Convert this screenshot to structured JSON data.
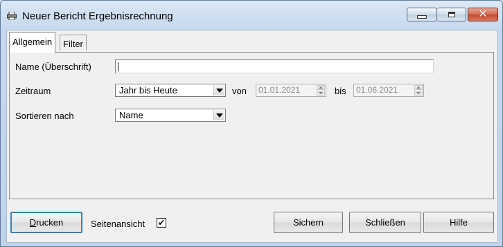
{
  "window": {
    "title": "Neuer Bericht Ergebnisrechnung",
    "controls": {
      "minimize": "minimize",
      "maximize": "maximize",
      "close": "✕"
    }
  },
  "tabs": [
    {
      "label": "Allgemein",
      "active": true
    },
    {
      "label": "Filter",
      "active": false
    }
  ],
  "form": {
    "name_label": "Name (Überschrift)",
    "name_value": "",
    "zeitraum_label": "Zeitraum",
    "zeitraum_value": "Jahr bis Heute",
    "von_label": "von",
    "von_value": "01.01.2021",
    "bis_label": "bis",
    "bis_value": "01.06.2021",
    "sortieren_label": "Sortieren nach",
    "sortieren_value": "Name"
  },
  "footer": {
    "drucken_underline": "D",
    "drucken_rest": "rucken",
    "seitenansicht_label": "Seitenansicht",
    "seitenansicht_checked": "✔",
    "sichern_label": "Sichern",
    "schliessen_label": "Schließen",
    "hilfe_label": "Hilfe"
  },
  "colors": {
    "title_bg": "#c6d9ee",
    "close_button": "#c44a31",
    "default_button_border": "#3c7fb1"
  }
}
